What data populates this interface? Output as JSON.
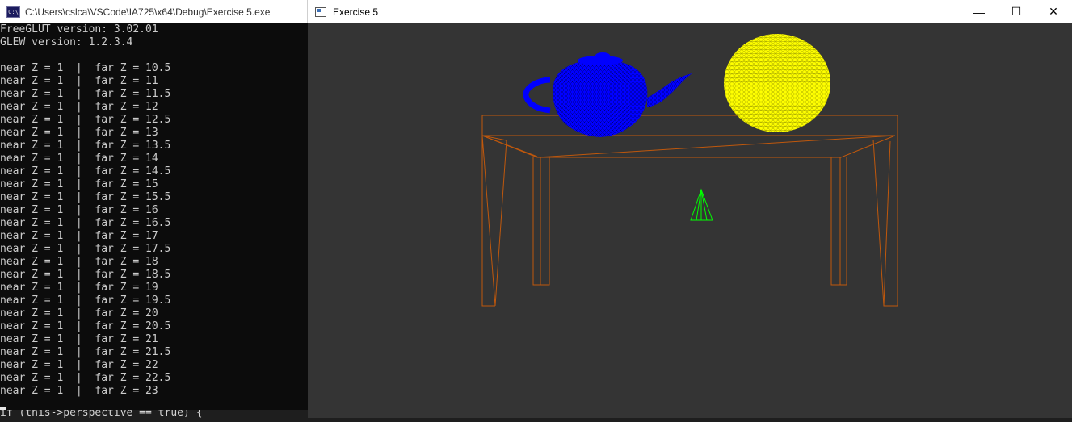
{
  "console": {
    "title": "C:\\Users\\cslca\\VSCode\\IA725\\x64\\Debug\\Exercise 5.exe",
    "icon": "cmd-icon",
    "header_lines": [
      "FreeGLUT version: 3.02.01",
      "GLEW version: 1.2.3.4",
      ""
    ],
    "lines": [
      "near Z = 1  |  far Z = 10.5",
      "near Z = 1  |  far Z = 11",
      "near Z = 1  |  far Z = 11.5",
      "near Z = 1  |  far Z = 12",
      "near Z = 1  |  far Z = 12.5",
      "near Z = 1  |  far Z = 13",
      "near Z = 1  |  far Z = 13.5",
      "near Z = 1  |  far Z = 14",
      "near Z = 1  |  far Z = 14.5",
      "near Z = 1  |  far Z = 15",
      "near Z = 1  |  far Z = 15.5",
      "near Z = 1  |  far Z = 16",
      "near Z = 1  |  far Z = 16.5",
      "near Z = 1  |  far Z = 17",
      "near Z = 1  |  far Z = 17.5",
      "near Z = 1  |  far Z = 18",
      "near Z = 1  |  far Z = 18.5",
      "near Z = 1  |  far Z = 19",
      "near Z = 1  |  far Z = 19.5",
      "near Z = 1  |  far Z = 20",
      "near Z = 1  |  far Z = 20.5",
      "near Z = 1  |  far Z = 21",
      "near Z = 1  |  far Z = 21.5",
      "near Z = 1  |  far Z = 22",
      "near Z = 1  |  far Z = 22.5",
      "near Z = 1  |  far Z = 23"
    ],
    "code_snippet": "if (this->perspective == true) {"
  },
  "gl_window": {
    "title": "Exercise 5",
    "minimize_label": "—",
    "maximize_label": "☐",
    "close_label": "✕",
    "background_color": "#343434",
    "objects": {
      "teapot_color": "#0000ff",
      "sphere_color": "#ffff00",
      "table_color": "#c0580c",
      "cone_color": "#00ff00"
    }
  }
}
